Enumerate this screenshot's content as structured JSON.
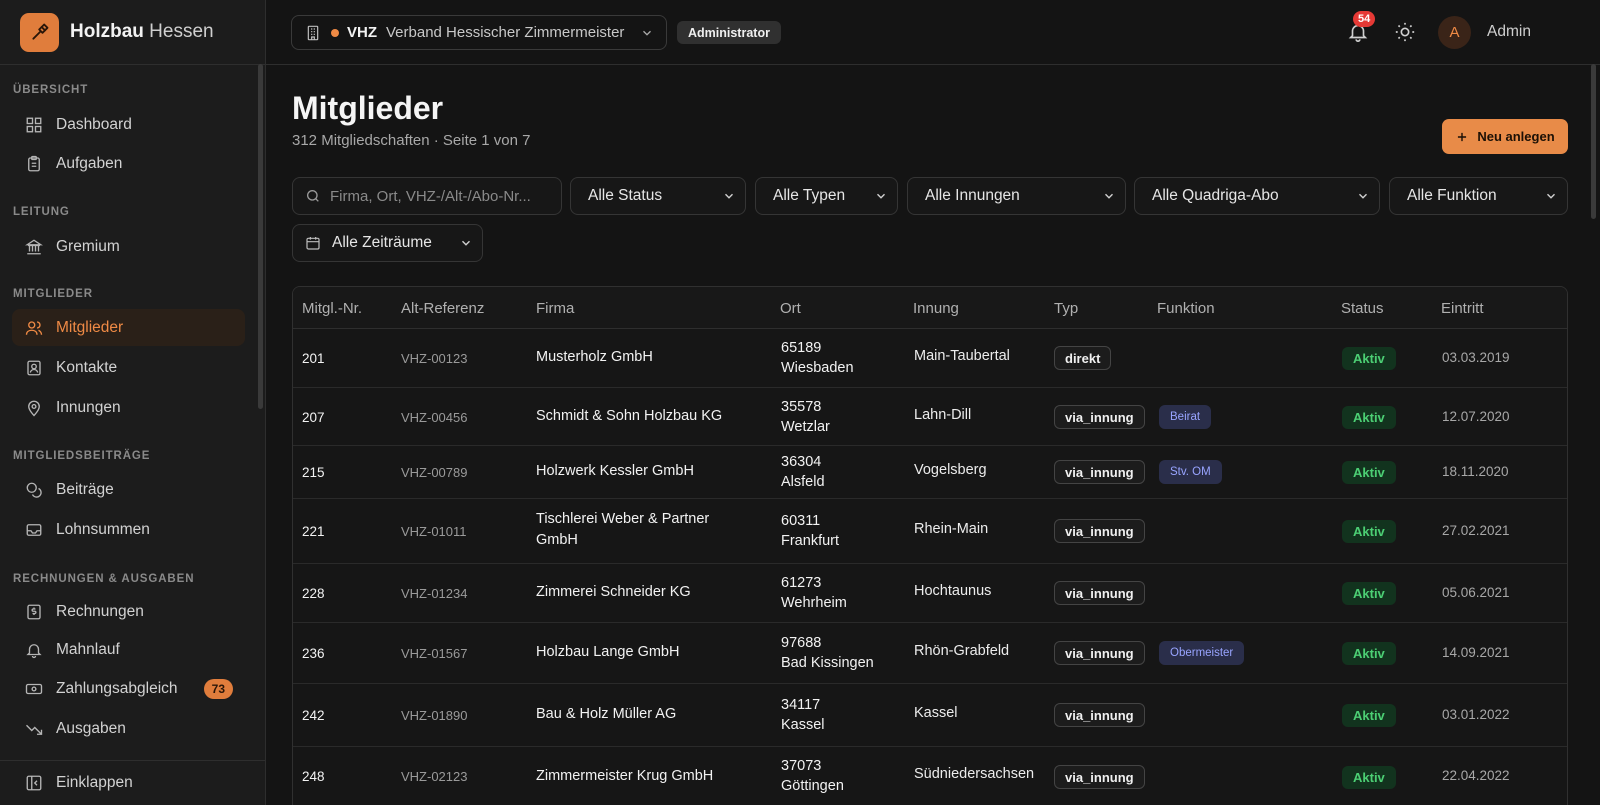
{
  "brand": {
    "name_bold": "Holzbau",
    "name_rest": "Hessen"
  },
  "sidebar": {
    "sections": [
      {
        "label": "ÜBERSICHT"
      },
      {
        "label": "LEITUNG"
      },
      {
        "label": "MITGLIEDER"
      },
      {
        "label": "MITGLIEDSBEITRÄGE"
      },
      {
        "label": "RECHNUNGEN & AUSGABEN"
      }
    ],
    "items": [
      {
        "label": "Dashboard",
        "icon": "dashboard-icon"
      },
      {
        "label": "Aufgaben",
        "icon": "clipboard-icon"
      },
      {
        "label": "Gremium",
        "icon": "landmark-icon"
      },
      {
        "label": "Mitglieder",
        "icon": "users-icon",
        "active": true
      },
      {
        "label": "Kontakte",
        "icon": "contact-icon"
      },
      {
        "label": "Innungen",
        "icon": "map-pin-icon"
      },
      {
        "label": "Beiträge",
        "icon": "coins-icon"
      },
      {
        "label": "Lohnsummen",
        "icon": "inbox-icon"
      },
      {
        "label": "Rechnungen",
        "icon": "receipt-icon"
      },
      {
        "label": "Mahnlauf",
        "icon": "bell-icon"
      },
      {
        "label": "Zahlungsabgleich",
        "icon": "banknote-icon",
        "badge": "73"
      },
      {
        "label": "Ausgaben",
        "icon": "trending-down-icon"
      }
    ],
    "collapse_label": "Einklappen"
  },
  "header": {
    "org_code": "VHZ",
    "org_name": "Verband Hessischer Zimmermeister",
    "role": "Administrator",
    "notification_count": "54",
    "avatar_initial": "A",
    "user_name": "Admin"
  },
  "page": {
    "title": "Mitglieder",
    "subtitle": "312 Mitgliedschaften · Seite 1 von 7",
    "new_button": "Neu anlegen"
  },
  "filters": {
    "search_placeholder": "Firma, Ort, VHZ-/Alt-/Abo-Nr...",
    "status": "Alle Status",
    "typen": "Alle Typen",
    "innungen": "Alle Innungen",
    "quadriga": "Alle Quadriga-Abo",
    "funktion": "Alle Funktion",
    "zeitraum": "Alle Zeiträume"
  },
  "table": {
    "columns": [
      "Mitgl.-Nr.",
      "Alt-Referenz",
      "Firma",
      "Ort",
      "Innung",
      "Typ",
      "Funktion",
      "Status",
      "Eintritt"
    ],
    "rows": [
      {
        "nr": "201",
        "ref": "VHZ-00123",
        "firma": "Musterholz GmbH",
        "plz": "65189",
        "ort": "Wiesbaden",
        "innung": "Main-Taubertal",
        "typ": "direkt",
        "funktion": "",
        "status": "Aktiv",
        "eintritt": "03.03.2019"
      },
      {
        "nr": "207",
        "ref": "VHZ-00456",
        "firma": "Schmidt & Sohn Holzbau KG",
        "plz": "35578",
        "ort": "Wetzlar",
        "innung": "Lahn-Dill",
        "typ": "via_innung",
        "funktion": "Beirat",
        "status": "Aktiv",
        "eintritt": "12.07.2020"
      },
      {
        "nr": "215",
        "ref": "VHZ-00789",
        "firma": "Holzwerk Kessler GmbH",
        "plz": "36304",
        "ort": "Alsfeld",
        "innung": "Vogelsberg",
        "typ": "via_innung",
        "funktion": "Stv. OM",
        "status": "Aktiv",
        "eintritt": "18.11.2020"
      },
      {
        "nr": "221",
        "ref": "VHZ-01011",
        "firma": "Tischlerei Weber & Partner GmbH",
        "plz": "60311",
        "ort": "Frankfurt",
        "innung": "Rhein-Main",
        "typ": "via_innung",
        "funktion": "",
        "status": "Aktiv",
        "eintritt": "27.02.2021"
      },
      {
        "nr": "228",
        "ref": "VHZ-01234",
        "firma": "Zimmerei Schneider KG",
        "plz": "61273",
        "ort": "Wehrheim",
        "innung": "Hochtaunus",
        "typ": "via_innung",
        "funktion": "",
        "status": "Aktiv",
        "eintritt": "05.06.2021"
      },
      {
        "nr": "236",
        "ref": "VHZ-01567",
        "firma": "Holzbau Lange GmbH",
        "plz": "97688",
        "ort": "Bad Kissingen",
        "innung": "Rhön-Grabfeld",
        "typ": "via_innung",
        "funktion": "Obermeister",
        "status": "Aktiv",
        "eintritt": "14.09.2021"
      },
      {
        "nr": "242",
        "ref": "VHZ-01890",
        "firma": "Bau & Holz Müller AG",
        "plz": "34117",
        "ort": "Kassel",
        "innung": "Kassel",
        "typ": "via_innung",
        "funktion": "",
        "status": "Aktiv",
        "eintritt": "03.01.2022"
      },
      {
        "nr": "248",
        "ref": "VHZ-02123",
        "firma": "Zimmermeister Krug GmbH",
        "plz": "37073",
        "ort": "Göttingen",
        "innung": "Südniedersachsen",
        "typ": "via_innung",
        "funktion": "",
        "status": "Aktiv",
        "eintritt": "22.04.2022"
      }
    ]
  },
  "colors": {
    "accent": "#e88b48",
    "status_green": "#4ccf74",
    "function_blue": "#98a4ff"
  }
}
